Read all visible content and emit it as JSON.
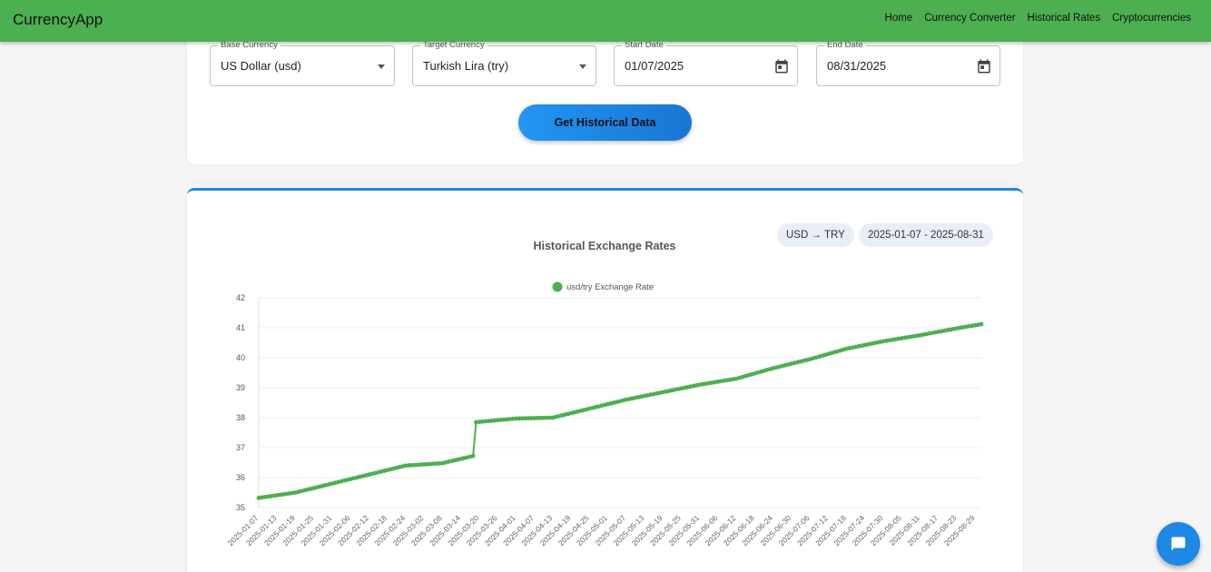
{
  "app": {
    "brand": "CurrencyApp"
  },
  "nav": {
    "home": "Home",
    "converter": "Currency Converter",
    "historical": "Historical Rates",
    "crypto": "Cryptocurrencies"
  },
  "form": {
    "base": {
      "label": "Base Currency",
      "value": "US Dollar (usd)"
    },
    "target": {
      "label": "Target Currency",
      "value": "Turkish Lira (try)"
    },
    "start": {
      "label": "Start Date",
      "value": "01/07/2025"
    },
    "end": {
      "label": "End Date",
      "value": "08/31/2025"
    },
    "submit_label": "Get Historical Data"
  },
  "chips": {
    "pair": "USD → TRY",
    "range": "2025-01-07 - 2025-08-31"
  },
  "colors": {
    "navbar": "#4caf50",
    "accent": "#1e88e5",
    "series": "#4caf50"
  },
  "icons": {
    "calendar": "calendar-icon",
    "chat": "chat-icon",
    "dropdown": "caret-down-icon"
  },
  "chart_data": {
    "type": "line",
    "title": "Historical Exchange Rates",
    "series": [
      {
        "name": "usd/try Exchange Rate"
      }
    ],
    "ylim": [
      35,
      42
    ],
    "y_ticks": [
      35,
      36,
      37,
      38,
      39,
      40,
      41,
      42
    ],
    "x_ticks": [
      "2025-01-07",
      "2025-01-13",
      "2025-01-19",
      "2025-01-25",
      "2025-01-31",
      "2025-02-06",
      "2025-02-12",
      "2025-02-18",
      "2025-02-24",
      "2025-03-02",
      "2025-03-08",
      "2025-03-14",
      "2025-03-20",
      "2025-03-26",
      "2025-04-01",
      "2025-04-07",
      "2025-04-13",
      "2025-04-19",
      "2025-04-25",
      "2025-05-01",
      "2025-05-07",
      "2025-05-13",
      "2025-05-19",
      "2025-05-25",
      "2025-05-31",
      "2025-06-06",
      "2025-06-12",
      "2025-06-18",
      "2025-06-24",
      "2025-06-30",
      "2025-07-06",
      "2025-07-12",
      "2025-07-18",
      "2025-07-24",
      "2025-07-30",
      "2025-08-05",
      "2025-08-11",
      "2025-08-17",
      "2025-08-23",
      "2025-08-29"
    ],
    "anchors": [
      {
        "date": "2025-01-07",
        "value": 35.32
      },
      {
        "date": "2025-01-19",
        "value": 35.5
      },
      {
        "date": "2025-01-31",
        "value": 35.8
      },
      {
        "date": "2025-02-12",
        "value": 36.1
      },
      {
        "date": "2025-02-24",
        "value": 36.4
      },
      {
        "date": "2025-03-08",
        "value": 36.48
      },
      {
        "date": "2025-03-18",
        "value": 36.72
      },
      {
        "date": "2025-03-19",
        "value": 37.85
      },
      {
        "date": "2025-04-01",
        "value": 37.97
      },
      {
        "date": "2025-04-13",
        "value": 38.0
      },
      {
        "date": "2025-04-25",
        "value": 38.3
      },
      {
        "date": "2025-05-07",
        "value": 38.6
      },
      {
        "date": "2025-05-19",
        "value": 38.85
      },
      {
        "date": "2025-05-31",
        "value": 39.1
      },
      {
        "date": "2025-06-12",
        "value": 39.3
      },
      {
        "date": "2025-06-24",
        "value": 39.65
      },
      {
        "date": "2025-07-06",
        "value": 39.95
      },
      {
        "date": "2025-07-18",
        "value": 40.3
      },
      {
        "date": "2025-07-30",
        "value": 40.55
      },
      {
        "date": "2025-08-11",
        "value": 40.75
      },
      {
        "date": "2025-08-23",
        "value": 40.98
      },
      {
        "date": "2025-08-31",
        "value": 41.12
      }
    ],
    "grid": true,
    "legend": "top-center"
  }
}
